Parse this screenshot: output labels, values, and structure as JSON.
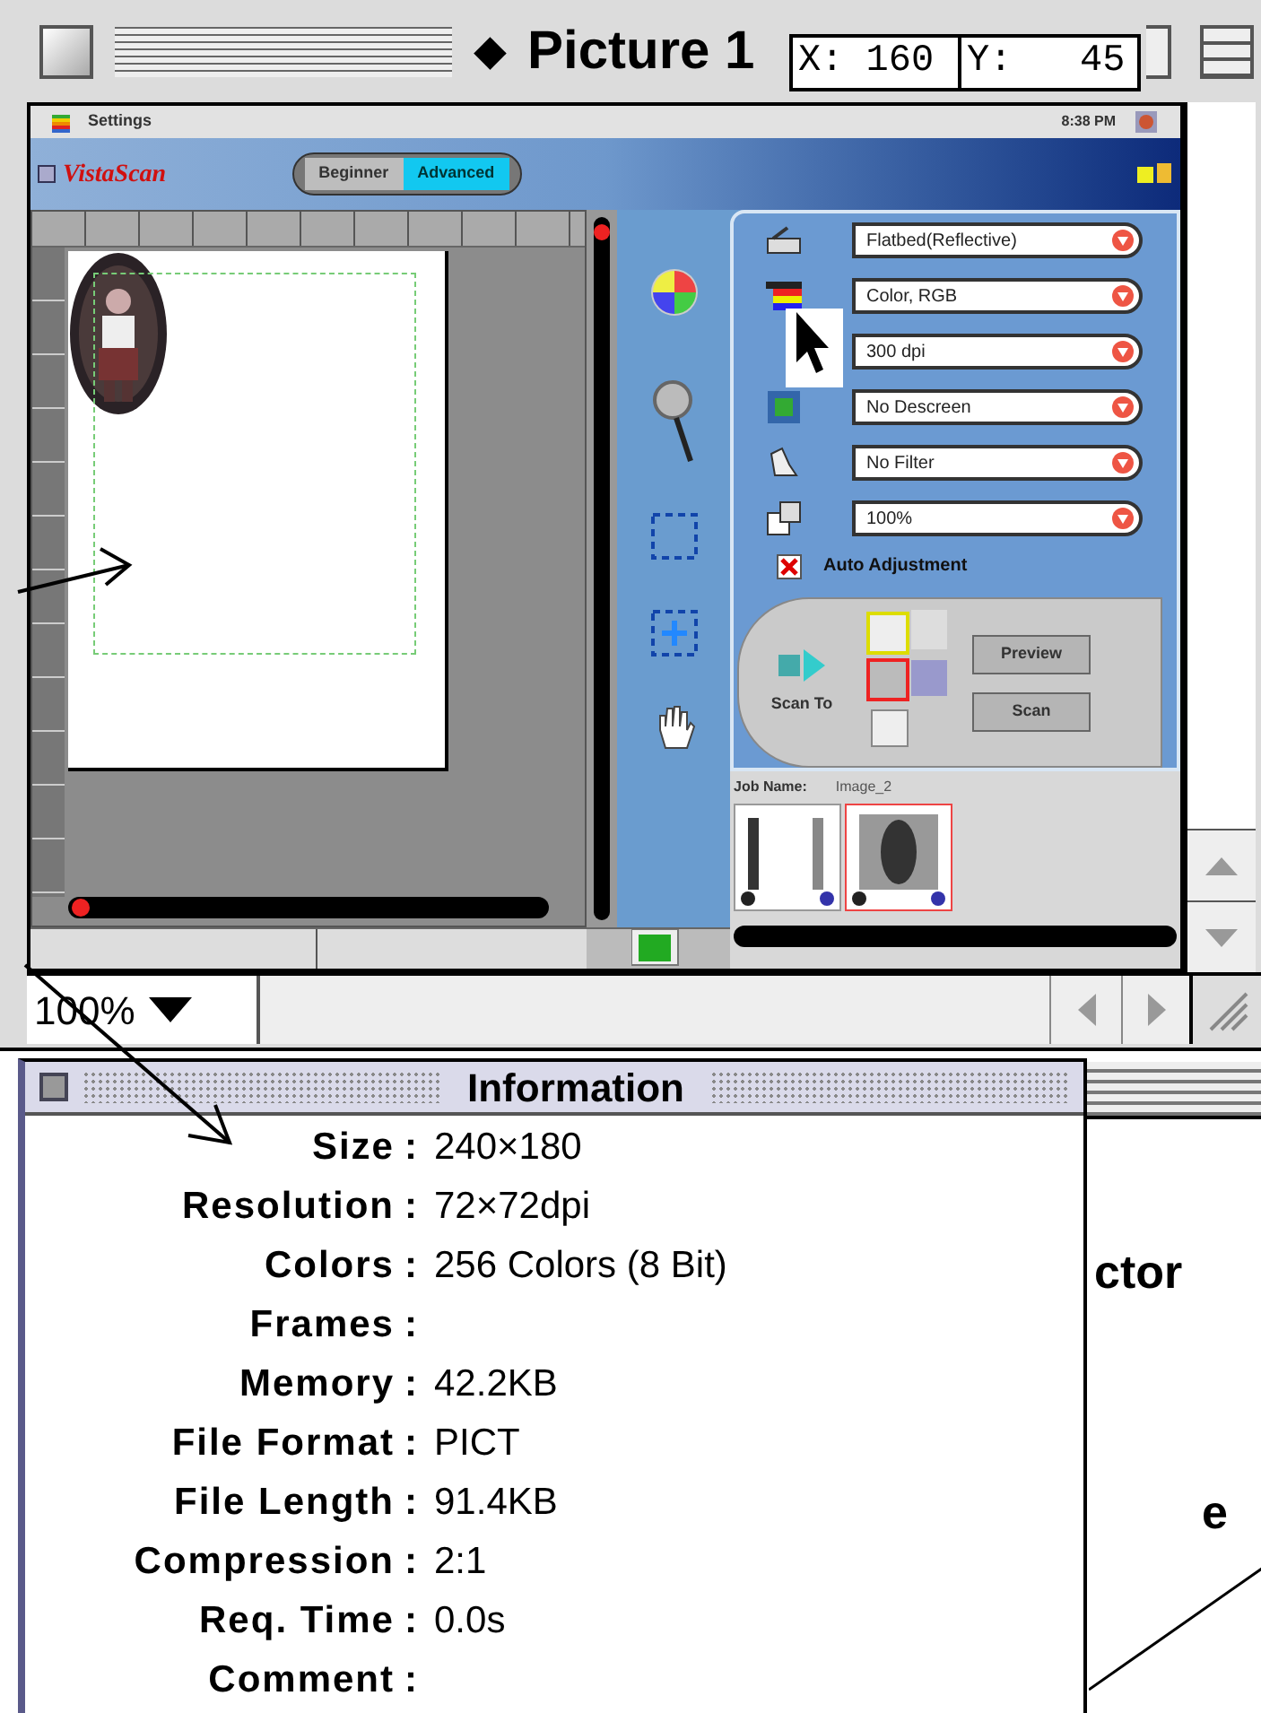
{
  "window": {
    "title_mark": "◆",
    "title": "Picture 1"
  },
  "coordinates": {
    "x": "X: 160",
    "y": "Y:   45"
  },
  "embedded_screenshot": {
    "menu_bar": {
      "menu": "Settings",
      "clock": "8:38 PM"
    },
    "app_logo": "VistaScan",
    "mode_tabs": [
      {
        "label": "Beginner",
        "selected": false
      },
      {
        "label": "Advanced",
        "selected": true
      }
    ],
    "settings": [
      {
        "value": "Flatbed(Reflective)"
      },
      {
        "value": "Color, RGB"
      },
      {
        "value": "300 dpi"
      },
      {
        "value": "No Descreen"
      },
      {
        "value": "No Filter"
      },
      {
        "value": "100%"
      }
    ],
    "auto_adjustment": {
      "label": "Auto Adjustment",
      "checked": true
    },
    "scan_to": "Scan To",
    "buttons": [
      "Preview",
      "Scan"
    ],
    "job": {
      "label": "Job Name:",
      "value": "Image_2"
    }
  },
  "zoom": "100%",
  "info_window": {
    "title": "Information",
    "fields": [
      {
        "label": "Size",
        "separator": ":",
        "value": "240×180"
      },
      {
        "label": "Resolution",
        "separator": ":",
        "value": "72×72dpi"
      },
      {
        "label": "Colors",
        "separator": ":",
        "value": "256 Colors (8 Bit)"
      },
      {
        "label": "Frames",
        "separator": ":"
      },
      {
        "label": "Memory",
        "separator": ":",
        "value": "42.2KB"
      },
      {
        "label": "File Format",
        "separator": ":",
        "value": "PICT"
      },
      {
        "label": "File Length",
        "separator": ":",
        "value": "91.4KB"
      },
      {
        "label": "Compression",
        "separator": ":",
        "value": "2:1"
      },
      {
        "label": "Req. Time",
        "separator": ":",
        "value": "0.0s"
      },
      {
        "label": "Comment",
        "separator": ":"
      }
    ]
  },
  "background_window": {
    "texts": [
      "ctor",
      "e"
    ]
  }
}
